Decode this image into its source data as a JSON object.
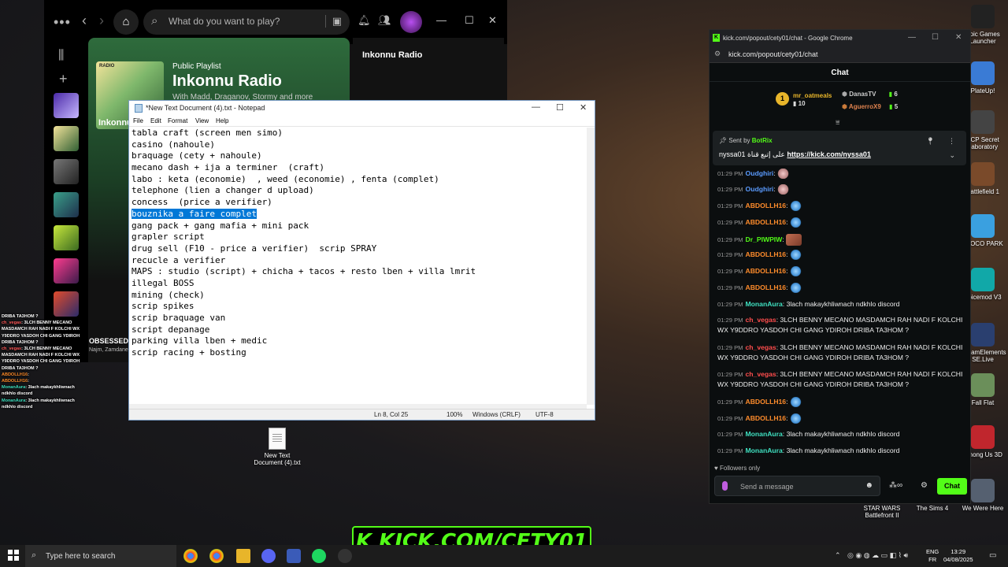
{
  "desktop": {
    "right_icons": [
      {
        "label": "Epic Games Launcher",
        "color": "#222222"
      },
      {
        "label": "PlateUp!",
        "color": "#3a7bd5"
      },
      {
        "label": "SCP Secret Laboratory",
        "color": "#444444"
      },
      {
        "label": "Battlefield 1",
        "color": "#7a4a2a"
      },
      {
        "label": "BLOCO PARK",
        "color": "#3aa0e0"
      },
      {
        "label": "Voicemod V3",
        "color": "#11a8a8"
      },
      {
        "label": "StreamElements SE.Live",
        "color": "#2a3f6f"
      },
      {
        "label": "Fall Flat",
        "color": "#6b8f5a"
      },
      {
        "label": "Among Us 3D",
        "color": "#c0262d"
      },
      {
        "label": "We Were Here",
        "color": "#556070"
      },
      {
        "label": "STAR WARS Battlefront II",
        "color": "#333333"
      },
      {
        "label": "The Sims 4",
        "color": "#2f8f4f"
      }
    ],
    "file_icon": {
      "label": "New Text Document (4).txt"
    }
  },
  "spotify": {
    "search_placeholder": "What do you want to play?",
    "playlist_type": "Public Playlist",
    "playlist_title": "Inkonnu Radio",
    "playlist_subtitle": "With Madd, Draganov, Stormy and more",
    "cover_radio": "RADIO",
    "cover_name": "Inkonnu",
    "right_panel_title": "Inkonnu Radio",
    "header_hash": "#",
    "header_title_letter": "Ti",
    "track_numbers": [
      "1",
      "3",
      "4"
    ],
    "sidebar_labels": [
      "Inkonnu",
      "Dancing",
      "DISCOVER WEEKLY"
    ],
    "obsessed": "OBSESSED",
    "obsessed_artists": "Najm, Zamdane"
  },
  "notepad": {
    "title": "*New Text Document (4).txt - Notepad",
    "menu": [
      "File",
      "Edit",
      "Format",
      "View",
      "Help"
    ],
    "lines": [
      "tabla craft (screen men simo)",
      "casino (nahoule)",
      "braquage (cety + nahoule)",
      "mecano dash + ija a terminer  (craft)",
      "labo : keta (economie)  , weed (economie) , fenta (complet)",
      "telephone (lien a changer d upload)",
      "concess  (price a verifier)",
      "bouznika a faire complet",
      "gang pack + gang mafia + mini pack",
      "grapler script",
      "drug sell (F10 - price a verifier)  scrip SPRAY",
      "recucle a verifier",
      "MAPS : studio (script) + chicha + tacos + resto lben + villa lmrit",
      "illegal BOSS",
      "mining (check)",
      "scrip spikes",
      "scrip braquage van",
      "script depanage",
      "parking villa lben + medic",
      "scrip racing + bosting"
    ],
    "selected_line_index": 7,
    "status": {
      "position": "Ln 8, Col 25",
      "zoom": "100%",
      "line_ending": "Windows (CRLF)",
      "encoding": "UTF-8"
    }
  },
  "overlay_chat": [
    {
      "user": "",
      "text": "DRIBA TA3HOM ?",
      "cls": ""
    },
    {
      "user": "ch_vegas",
      "text": ": 3LCH BENNY MECANO MASDAMCH RAH NADI F KOLCHI WX Y9DDRO YASDOH CHI GANG YDIROH DRIBA TA3HOM ?",
      "cls": "u-red"
    },
    {
      "user": "ch_vegas",
      "text": ": 3LCH BENNY MECANO MASDAMCH RAH NADI F KOLCHI WX Y9DDRO YASDOH CHI GANG YDIROH DRIBA TA3HOM ?",
      "cls": "u-red"
    },
    {
      "user": "ABDOLLH16",
      "text": ":",
      "cls": "u-orange"
    },
    {
      "user": "ABDOLLH16",
      "text": ":",
      "cls": "u-orange"
    },
    {
      "user": "MonanAura",
      "text": ": 3lach makaykhliwnach ndkhlo discord",
      "cls": "u-teal"
    },
    {
      "user": "MonanAura",
      "text": ": 3lach makaykhliwnach ndkhlo discord",
      "cls": "u-teal"
    }
  ],
  "chrome": {
    "title": "kick.com/popout/cety01/chat - Google Chrome",
    "url": "kick.com/popout/cety01/chat",
    "chat_header": "Chat",
    "leaders": [
      {
        "rank": "1",
        "name": "mr_oatmeals",
        "count": "10"
      },
      {
        "name": "DanasTV",
        "count": "6"
      },
      {
        "name": "AguerroX9",
        "count": "5"
      }
    ],
    "pinned": {
      "sent_by": "Sent by",
      "bot": "BotRix",
      "message": "nyssa01 على إتبع قناة",
      "link": "https://kick.com/nyssa01"
    },
    "messages": [
      {
        "time": "01:29 PM",
        "user": "Oudghiri",
        "color": "#5a9bff",
        "text": "",
        "emote": "hand"
      },
      {
        "time": "01:29 PM",
        "user": "Oudghiri",
        "color": "#5a9bff",
        "text": "",
        "emote": "hand"
      },
      {
        "time": "01:29 PM",
        "user": "ABDOLLH16",
        "color": "#ff8c2b",
        "text": "",
        "emote": "bf"
      },
      {
        "time": "01:29 PM",
        "user": "ABDOLLH16",
        "color": "#ff8c2b",
        "text": "",
        "emote": "bf"
      },
      {
        "time": "01:29 PM",
        "user": "Dr_PIWPIW",
        "color": "#53fc18",
        "text": "",
        "emote": "face"
      },
      {
        "time": "01:29 PM",
        "user": "ABDOLLH16",
        "color": "#ff8c2b",
        "text": "",
        "emote": "bf"
      },
      {
        "time": "01:29 PM",
        "user": "ABDOLLH16",
        "color": "#ff8c2b",
        "text": "",
        "emote": "bf"
      },
      {
        "time": "01:29 PM",
        "user": "ABDOLLH16",
        "color": "#ff8c2b",
        "text": "",
        "emote": "bf"
      },
      {
        "time": "01:29 PM",
        "user": "MonanAura",
        "color": "#3fe0c0",
        "text": "3lach makaykhliwnach ndkhlo discord",
        "emote": ""
      },
      {
        "time": "01:29 PM",
        "user": "ch_vegas",
        "color": "#ff4d4d",
        "text": "3LCH BENNY MECANO MASDAMCH RAH NADI F KOLCHI WX Y9DDRO YASDOH CHI GANG YDIROH DRIBA TA3HOM ?",
        "emote": ""
      },
      {
        "time": "01:29 PM",
        "user": "ch_vegas",
        "color": "#ff4d4d",
        "text": "3LCH BENNY MECANO MASDAMCH RAH NADI F KOLCHI WX Y9DDRO YASDOH CHI GANG YDIROH DRIBA TA3HOM ?",
        "emote": ""
      },
      {
        "time": "01:29 PM",
        "user": "ch_vegas",
        "color": "#ff4d4d",
        "text": "3LCH BENNY MECANO MASDAMCH RAH NADI F KOLCHI WX Y9DDRO YASDOH CHI GANG YDIROH DRIBA TA3HOM ?",
        "emote": ""
      },
      {
        "time": "01:29 PM",
        "user": "ABDOLLH16",
        "color": "#ff8c2b",
        "text": "",
        "emote": "bf"
      },
      {
        "time": "01:29 PM",
        "user": "ABDOLLH16",
        "color": "#ff8c2b",
        "text": "",
        "emote": "bf"
      },
      {
        "time": "01:29 PM",
        "user": "MonanAura",
        "color": "#3fe0c0",
        "text": "3lach makaykhliwnach ndkhlo discord",
        "emote": ""
      },
      {
        "time": "01:29 PM",
        "user": "MonanAura",
        "color": "#3fe0c0",
        "text": "3lach makaykhliwnach ndkhlo discord",
        "emote": ""
      }
    ],
    "followers_only": "Followers only",
    "send_placeholder": "Send a message",
    "chat_button": "Chat"
  },
  "kick_banner": "K KICK.COM/CETY01",
  "taskbar": {
    "search_placeholder": "Type here to search",
    "lang_top": "ENG",
    "lang_bottom": "FR",
    "time": "13:29",
    "date": "04/08/2025"
  }
}
